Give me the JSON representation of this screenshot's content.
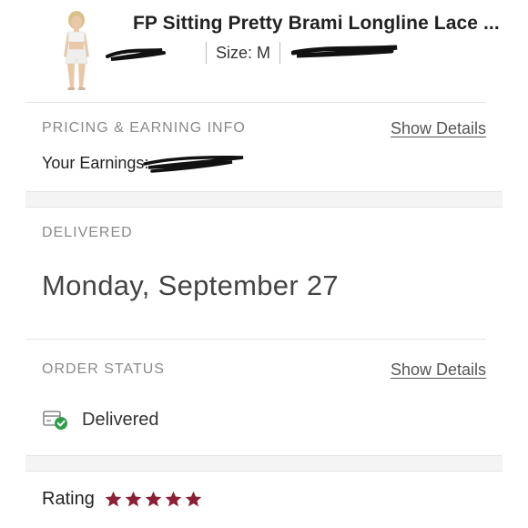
{
  "item": {
    "title": "FP Sitting Pretty Brami Longline Lace ...",
    "size_label": "Size: M",
    "price_redacted": true,
    "earnings_redacted": true
  },
  "pricing": {
    "label": "PRICING & EARNING INFO",
    "link": "Show Details",
    "earnings_label": "Your Earnings:"
  },
  "delivered": {
    "label": "DELIVERED",
    "date": "Monday, September 27"
  },
  "order_status": {
    "label": "ORDER STATUS",
    "link": "Show Details",
    "status": "Delivered",
    "status_icon": "package-check-icon"
  },
  "rating": {
    "label": "Rating",
    "stars": 5,
    "max_stars": 5,
    "star_color": "#8b2135"
  },
  "colors": {
    "text": "#222222",
    "muted": "#8a8a8a",
    "check_green": "#2e9e4a",
    "star": "#8b2135"
  }
}
